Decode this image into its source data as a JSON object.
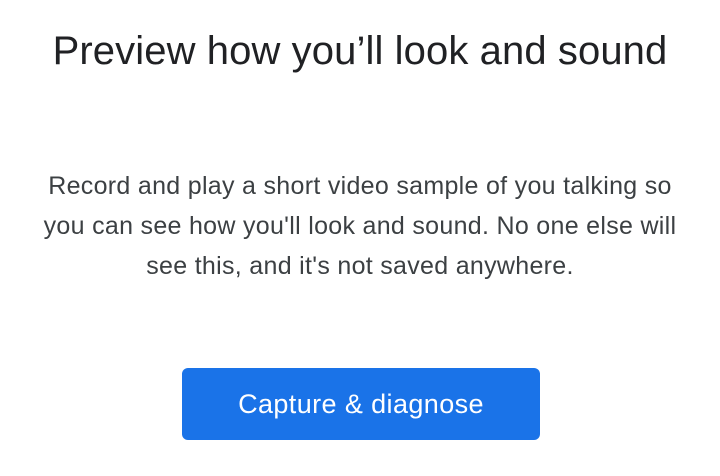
{
  "dialog": {
    "title": "Preview how you’ll look and sound",
    "description": "Record and play a short video sample of you talking so you can see how you'll look and sound. No one else will see this, and it's not saved anywhere.",
    "primary_button_label": "Capture & diagnose"
  },
  "colors": {
    "primary_button_bg": "#1a73e8",
    "title_text": "#202124",
    "body_text": "#3c4043",
    "background": "#ffffff"
  }
}
